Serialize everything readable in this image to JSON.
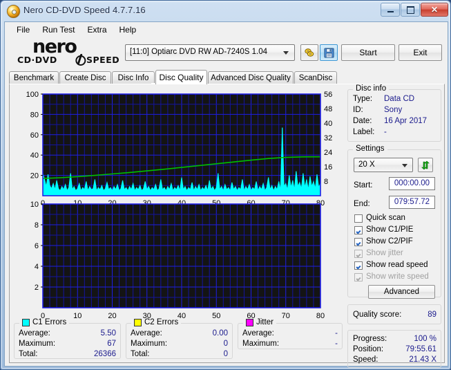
{
  "window": {
    "title": "Nero CD-DVD Speed 4.7.7.16",
    "icon": "nero-disc-icon",
    "minimize_label": "Minimize",
    "maximize_label": "Maximize",
    "close_label": "✕"
  },
  "menu": {
    "items": [
      {
        "label": "File"
      },
      {
        "label": "Run Test"
      },
      {
        "label": "Extra"
      },
      {
        "label": "Help"
      }
    ]
  },
  "logo": {
    "word": "nero",
    "sub_left": "CD·DVD",
    "sub_right": "SPEED"
  },
  "toolbar": {
    "drive": "[11:0]   Optiarc DVD RW AD-7240S 1.04",
    "scan_icon": "disc-scan-icon",
    "save_icon": "floppy-save-icon",
    "start_label": "Start",
    "exit_label": "Exit"
  },
  "tabs": [
    {
      "label": "Benchmark",
      "active": false
    },
    {
      "label": "Create Disc",
      "active": false
    },
    {
      "label": "Disc Info",
      "active": false
    },
    {
      "label": "Disc Quality",
      "active": true
    },
    {
      "label": "Advanced Disc Quality",
      "active": false
    },
    {
      "label": "ScanDisc",
      "active": false
    }
  ],
  "disc_info": {
    "legend": "Disc info",
    "rows": [
      {
        "label": "Type:",
        "value": "Data CD"
      },
      {
        "label": "ID:",
        "value": "Sony"
      },
      {
        "label": "Date:",
        "value": "16 Apr 2017"
      },
      {
        "label": "Label:",
        "value": "-"
      }
    ]
  },
  "settings": {
    "legend": "Settings",
    "speed": "20 X",
    "refresh_icon": "refresh-arrows-icon",
    "start_label": "Start:",
    "start_value": "000:00.00",
    "end_label": "End:",
    "end_value": "079:57.72",
    "checkboxes": [
      {
        "label": "Quick scan",
        "checked": false,
        "disabled": false
      },
      {
        "label": "Show C1/PIE",
        "checked": true,
        "disabled": false
      },
      {
        "label": "Show C2/PIF",
        "checked": true,
        "disabled": false
      },
      {
        "label": "Show jitter",
        "checked": true,
        "disabled": true
      },
      {
        "label": "Show read speed",
        "checked": true,
        "disabled": false
      },
      {
        "label": "Show write speed",
        "checked": true,
        "disabled": true
      }
    ],
    "advanced_label": "Advanced"
  },
  "quality": {
    "label": "Quality score:",
    "value": "89"
  },
  "progress": {
    "rows": [
      {
        "label": "Progress:",
        "value": "100 %"
      },
      {
        "label": "Position:",
        "value": "79:55.61"
      },
      {
        "label": "Speed:",
        "value": "21.43 X"
      }
    ]
  },
  "stats": {
    "c1": {
      "title": "C1 Errors",
      "color": "#00FFFF",
      "rows": [
        {
          "label": "Average:",
          "value": "5.50"
        },
        {
          "label": "Maximum:",
          "value": "67"
        },
        {
          "label": "Total:",
          "value": "26366"
        }
      ]
    },
    "c2": {
      "title": "C2 Errors",
      "color": "#FFFF00",
      "rows": [
        {
          "label": "Average:",
          "value": "0.00"
        },
        {
          "label": "Maximum:",
          "value": "0"
        },
        {
          "label": "Total:",
          "value": "0"
        }
      ]
    },
    "jitter": {
      "title": "Jitter",
      "color": "#FF00FF",
      "rows": [
        {
          "label": "Average:",
          "value": "-"
        },
        {
          "label": "Maximum:",
          "value": "-"
        }
      ]
    }
  },
  "chart_data": [
    {
      "type": "area",
      "name": "c1-errors-chart",
      "title": "C1/PIE errors vs disc position",
      "xlabel": "",
      "ylabel": "",
      "xlim": [
        0,
        80
      ],
      "ylim": [
        0,
        100
      ],
      "xticks": [
        0,
        10,
        20,
        30,
        40,
        50,
        60,
        70,
        80
      ],
      "yticks": [
        0,
        20,
        40,
        60,
        80,
        100
      ],
      "y2lim": [
        0,
        56
      ],
      "y2ticks": [
        8,
        16,
        24,
        32,
        40,
        48,
        56
      ],
      "grid": true,
      "background": "#141414",
      "gridcolor": "#0000CC",
      "legend": "none",
      "series": [
        {
          "name": "C1 Errors",
          "color": "#00FFFF",
          "type": "area",
          "x": [
            0,
            0.5,
            1,
            1.5,
            2,
            2.5,
            3,
            3.5,
            4,
            4.5,
            5,
            5.5,
            6,
            6.5,
            7,
            7.5,
            8,
            8.5,
            9,
            9.5,
            10,
            10.5,
            11,
            11.5,
            12,
            12.5,
            13,
            13.5,
            14,
            14.5,
            15,
            15.5,
            16,
            16.5,
            17,
            17.5,
            18,
            18.5,
            19,
            19.5,
            20,
            20.5,
            21,
            21.5,
            22,
            22.5,
            23,
            23.5,
            24,
            24.5,
            25,
            25.5,
            26,
            26.5,
            27,
            27.5,
            28,
            28.5,
            29,
            29.5,
            30,
            30.5,
            31,
            31.5,
            32,
            32.5,
            33,
            33.5,
            34,
            34.5,
            35,
            35.5,
            36,
            36.5,
            37,
            37.5,
            38,
            38.5,
            39,
            39.5,
            40,
            40.5,
            41,
            41.5,
            42,
            42.5,
            43,
            43.5,
            44,
            44.5,
            45,
            45.5,
            46,
            46.5,
            47,
            47.5,
            48,
            48.5,
            49,
            49.5,
            50,
            50.5,
            51,
            51.5,
            52,
            52.5,
            53,
            53.5,
            54,
            54.5,
            55,
            55.5,
            56,
            56.5,
            57,
            57.5,
            58,
            58.5,
            59,
            59.5,
            60,
            60.5,
            61,
            61.5,
            62,
            62.5,
            63,
            63.5,
            64,
            64.5,
            65,
            65.5,
            66,
            66.5,
            67,
            67.5,
            68,
            68.5,
            69,
            69.5,
            70,
            70.5,
            71,
            71.5,
            72,
            72.5,
            73,
            73.5,
            74,
            74.5,
            75,
            75.5,
            76,
            76.5,
            77,
            77.5,
            78,
            78.5,
            79,
            79.5,
            80
          ],
          "y": [
            22,
            16,
            9,
            21,
            10,
            7,
            12,
            6,
            15,
            7,
            5,
            9,
            6,
            11,
            5,
            8,
            22,
            6,
            9,
            5,
            7,
            12,
            5,
            8,
            6,
            14,
            5,
            9,
            6,
            7,
            16,
            5,
            8,
            6,
            10,
            5,
            7,
            13,
            6,
            8,
            5,
            9,
            6,
            11,
            5,
            7,
            15,
            6,
            8,
            5,
            9,
            6,
            12,
            5,
            8,
            6,
            10,
            5,
            7,
            14,
            6,
            9,
            5,
            8,
            6,
            11,
            5,
            7,
            16,
            6,
            8,
            5,
            9,
            6,
            12,
            5,
            8,
            6,
            10,
            5,
            18,
            6,
            9,
            5,
            8,
            6,
            13,
            5,
            9,
            6,
            11,
            5,
            8,
            6,
            10,
            5,
            15,
            6,
            9,
            5,
            8,
            22,
            6,
            9,
            5,
            11,
            6,
            8,
            5,
            13,
            6,
            9,
            5,
            8,
            6,
            16,
            5,
            9,
            6,
            11,
            5,
            8,
            6,
            14,
            5,
            9,
            6,
            12,
            5,
            8,
            18,
            6,
            10,
            5,
            9,
            6,
            14,
            5,
            67,
            9,
            12,
            6,
            20,
            8,
            15,
            6,
            24,
            9,
            13,
            7,
            22,
            8,
            16,
            6,
            19,
            9,
            14,
            7,
            21,
            8,
            12,
            6,
            18,
            9,
            11
          ]
        },
        {
          "name": "Read speed",
          "color": "#00C000",
          "type": "line",
          "axis": "y2",
          "x": [
            0,
            5,
            10,
            15,
            20,
            25,
            30,
            35,
            40,
            45,
            50,
            55,
            60,
            65,
            70,
            75,
            80
          ],
          "y": [
            9.5,
            9.9,
            10.5,
            11.2,
            12.0,
            12.8,
            13.7,
            14.6,
            15.6,
            16.6,
            17.6,
            18.6,
            19.6,
            20.5,
            21.1,
            21.4,
            21.43
          ]
        }
      ]
    },
    {
      "type": "area",
      "name": "c2-errors-chart",
      "title": "C2/PIF errors vs disc position",
      "xlabel": "",
      "ylabel": "",
      "xlim": [
        0,
        80
      ],
      "ylim": [
        0,
        10
      ],
      "xticks": [
        0,
        10,
        20,
        30,
        40,
        50,
        60,
        70,
        80
      ],
      "yticks": [
        0,
        2,
        4,
        6,
        8,
        10
      ],
      "grid": true,
      "background": "#141414",
      "gridcolor": "#0000CC",
      "legend": "none",
      "series": [
        {
          "name": "C2 Errors",
          "color": "#FFFF00",
          "type": "area",
          "x": [
            0,
            80
          ],
          "y": [
            0,
            0
          ]
        }
      ]
    }
  ]
}
